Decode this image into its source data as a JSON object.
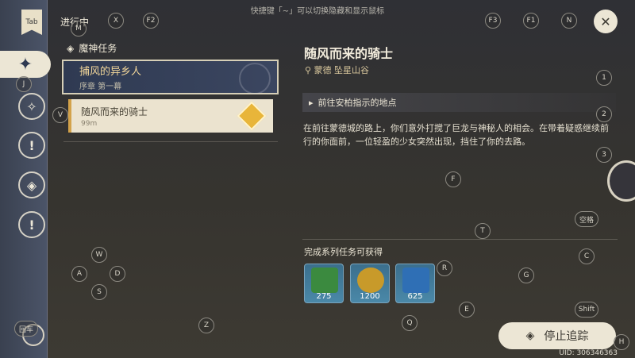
{
  "top_hint": "快捷键「~」可以切换隐藏和显示鼠标",
  "sidebar": {
    "tab_label": "Tab",
    "items": [
      {
        "icon": "compass-icon",
        "active": true
      },
      {
        "icon": "archon-quest-icon",
        "active": false
      },
      {
        "icon": "story-quest-icon",
        "active": false
      },
      {
        "icon": "world-quest-icon",
        "active": false
      },
      {
        "icon": "commission-icon",
        "active": false
      }
    ]
  },
  "quest_list": {
    "header": "进行中",
    "category": "魔神任务",
    "quest": {
      "name": "捕风的异乡人",
      "subtitle": "序章 第一幕"
    },
    "subquest": {
      "name": "随风而来的骑士",
      "distance": "99m"
    }
  },
  "detail": {
    "title": "随风而来的骑士",
    "location": "蒙德 坠星山谷",
    "objective": "前往安柏指示的地点",
    "description": "在前往蒙德城的路上，你们意外打搅了巨龙与神秘人的相会。在带着疑惑继续前行的你面前，一位轻盈的少女突然出现，挡住了你的去路。",
    "rewards_label": "完成系列任务可获得",
    "rewards": [
      {
        "icon": "adventure-exp-icon",
        "count": "275"
      },
      {
        "icon": "mora-icon",
        "count": "1200"
      },
      {
        "icon": "character-exp-icon",
        "count": "625"
      }
    ],
    "stop_button": "停止追踪"
  },
  "uid": "UID: 306346363",
  "key_hints": {
    "X": "X",
    "F2": "F2",
    "F3": "F3",
    "F1": "F1",
    "N": "N",
    "M": "M",
    "J": "J",
    "V": "V",
    "one": "1",
    "two": "2",
    "three": "3",
    "F": "F",
    "space": "空格",
    "T": "T",
    "W": "W",
    "A": "A",
    "D": "D",
    "S": "S",
    "R": "R",
    "C": "C",
    "G": "G",
    "E": "E",
    "Shift": "Shift",
    "Z": "Z",
    "Q": "Q",
    "H": "H",
    "enter": "回车"
  }
}
